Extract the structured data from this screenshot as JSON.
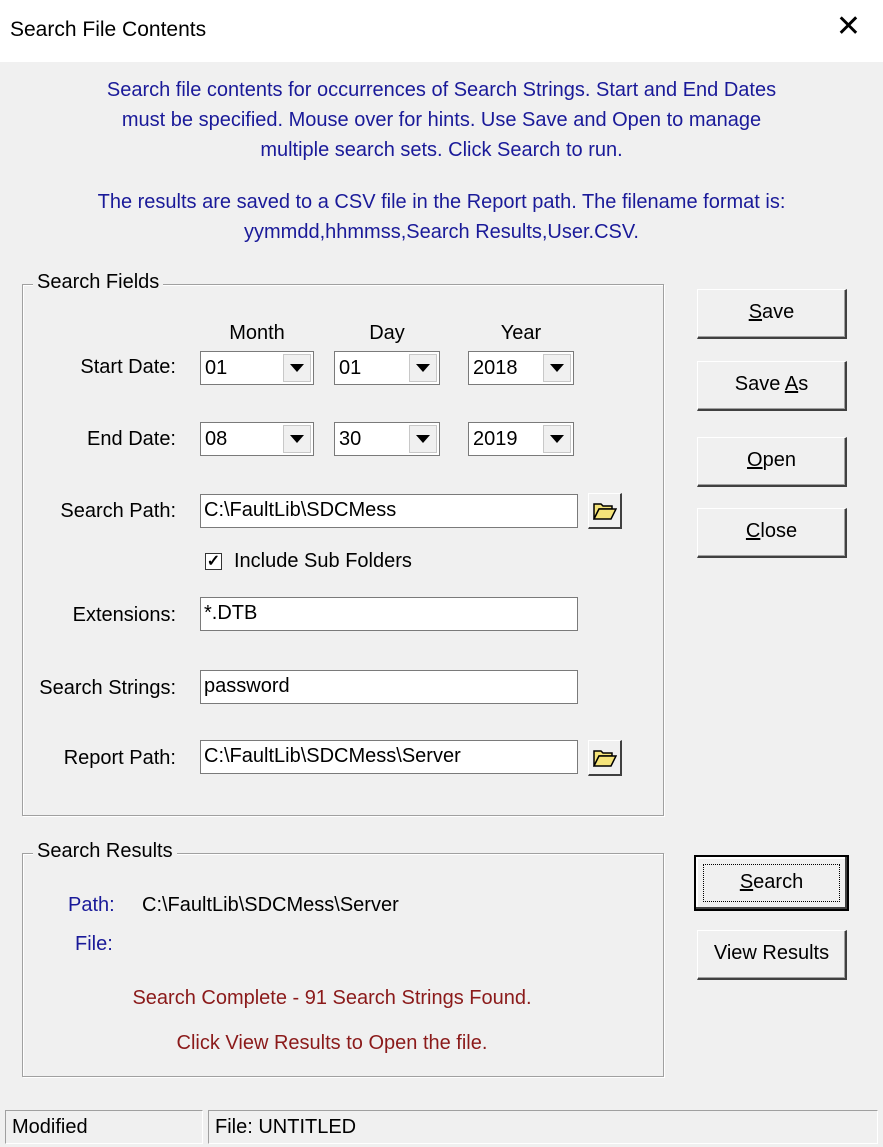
{
  "window": {
    "title": "Search File Contents",
    "close_symbol": "✕"
  },
  "info": {
    "line1": "Search file contents for occurrences of Search Strings. Start and End Dates",
    "line2": "must be specified. Mouse over for hints. Use Save and Open to manage",
    "line3": "multiple search sets. Click Search to run.",
    "line4": "The results are saved to a CSV file in the Report path. The filename format is:",
    "line5": "yymmdd,hhmmss,Search Results,User.CSV."
  },
  "search_fields": {
    "legend": "Search Fields",
    "col_month": "Month",
    "col_day": "Day",
    "col_year": "Year",
    "start_label": "Start Date:",
    "start_month": "01",
    "start_day": "01",
    "start_year": "2018",
    "end_label": "End Date:",
    "end_month": "08",
    "end_day": "30",
    "end_year": "2019",
    "search_path_label": "Search Path:",
    "search_path": "C:\\FaultLib\\SDCMess",
    "include_subfolders_label": "Include Sub Folders",
    "include_subfolders": true,
    "extensions_label": "Extensions:",
    "extensions": "*.DTB",
    "search_strings_label": "Search Strings:",
    "search_strings": "password",
    "report_path_label": "Report Path:",
    "report_path": "C:\\FaultLib\\SDCMess\\Server"
  },
  "buttons": {
    "save": "ave",
    "save_u": "S",
    "save_as_pre": "Save ",
    "save_as_u": "A",
    "save_as_post": "s",
    "open_u": "O",
    "open": "pen",
    "close_u": "C",
    "close": "lose",
    "search_u": "S",
    "search": "earch",
    "view_results": "View Results"
  },
  "results": {
    "legend": "Search Results",
    "path_label": "Path:",
    "path_value": "C:\\FaultLib\\SDCMess\\Server",
    "file_label": "File:",
    "file_value": "",
    "status1": "Search Complete - 91 Search Strings Found.",
    "status2": "Click View Results to Open the file."
  },
  "statusbar": {
    "left": "Modified",
    "right": "File: UNTITLED"
  },
  "colors": {
    "info_text": "#1a1a99",
    "status_text": "#8b1a1a",
    "folder_icon": "#f5e47a"
  }
}
